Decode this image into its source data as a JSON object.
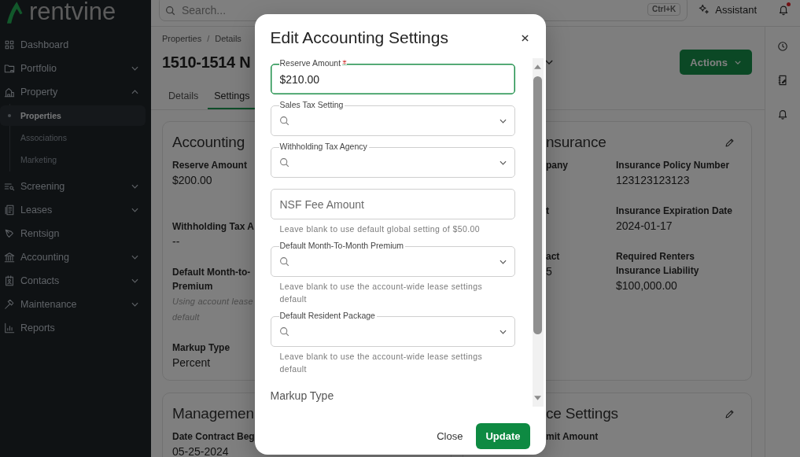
{
  "sidebar": {
    "logo": "rentvine",
    "items": [
      {
        "label": "Dashboard",
        "kind": "link",
        "selected": false
      },
      {
        "label": "Portfolio",
        "kind": "group",
        "selected": false,
        "expanded": false
      },
      {
        "label": "Property",
        "kind": "group",
        "selected": false,
        "expanded": true,
        "children": [
          {
            "label": "Properties",
            "selected": true
          },
          {
            "label": "Associations",
            "selected": false
          },
          {
            "label": "Marketing",
            "selected": false
          }
        ]
      },
      {
        "label": "Screening",
        "kind": "group",
        "selected": false,
        "expanded": false
      },
      {
        "label": "Leases",
        "kind": "group",
        "selected": false,
        "expanded": false
      },
      {
        "label": "Rentsign",
        "kind": "link",
        "selected": false
      },
      {
        "label": "Accounting",
        "kind": "group",
        "selected": false,
        "expanded": false
      },
      {
        "label": "Contacts",
        "kind": "group",
        "selected": false,
        "expanded": false
      },
      {
        "label": "Maintenance",
        "kind": "group",
        "selected": false,
        "expanded": false
      },
      {
        "label": "Reports",
        "kind": "link",
        "selected": false
      }
    ]
  },
  "topbar": {
    "search": {
      "placeholder": "Search...",
      "shortcut": "Ctrl+K"
    },
    "assistant": "Assistant",
    "notifications": {
      "unread": true
    }
  },
  "page": {
    "breadcrumb": {
      "items": [
        "Properties",
        "Details"
      ],
      "separator": "/"
    },
    "title": "1510-1514 N",
    "actions": "Actions",
    "tabs": [
      {
        "label": "Details",
        "selected": false
      },
      {
        "label": "Settings",
        "selected": true
      }
    ]
  },
  "cards": [
    {
      "kind": "left",
      "title": "Accounting",
      "fields": [
        {
          "label": [
            "Reserve Amount"
          ],
          "value": "$200.00"
        },
        {
          "label": [
            "Withholding Tax A"
          ],
          "value": "--"
        },
        {
          "label": [
            "Default Month-to-",
            "Premium"
          ],
          "note": [
            "Using account lease",
            "default"
          ]
        },
        {
          "label": [
            "Markup Type"
          ],
          "value": "Percent"
        }
      ]
    },
    {
      "kind": "right",
      "title": "nsurance",
      "fields": [
        {
          "label": [
            "pany"
          ]
        },
        {
          "label": [
            "Insurance Policy Number"
          ],
          "value": "123123123123"
        },
        {
          "label": [
            "t"
          ]
        },
        {
          "label": [
            "Insurance Expiration Date"
          ],
          "value": "2024-01-17"
        },
        {
          "label": [
            "act"
          ],
          "value": "5"
        },
        {
          "label": [
            "Required Renters Insurance Liability"
          ],
          "value": "$100,000.00"
        }
      ]
    },
    {
      "kind": "left",
      "title": "Managemen",
      "fields": [
        {
          "label": [
            "Date Contract Beg"
          ],
          "value": "05-25-2024"
        }
      ]
    },
    {
      "kind": "right",
      "title": "ce Settings",
      "fields": [
        {
          "label": [
            "mit Amount"
          ]
        }
      ]
    }
  ],
  "modal": {
    "title": "Edit Accounting Settings",
    "fields": [
      {
        "kind": "text",
        "label": "Reserve Amount",
        "required": true,
        "focused": true,
        "value": "$210.00"
      },
      {
        "kind": "select",
        "label": "Sales Tax Setting",
        "required": false,
        "focused": false
      },
      {
        "kind": "select",
        "label": "Withholding Tax Agency",
        "required": false,
        "focused": false
      },
      {
        "kind": "text",
        "placeholder": "NSF Fee Amount",
        "required": false,
        "focused": false,
        "helper": "Leave blank to use default global setting of $50.00"
      },
      {
        "kind": "select",
        "label": "Default Month-To-Month Premium",
        "required": false,
        "focused": false,
        "helper": "Leave blank to use the account-wide lease settings default"
      },
      {
        "kind": "select",
        "label": "Default Resident Package",
        "required": false,
        "focused": false,
        "helper": "Leave blank to use the account-wide lease settings default"
      },
      {
        "kind": "section",
        "label": "Markup Type"
      }
    ],
    "buttons": [
      {
        "label": "Close",
        "kind": "secondary"
      },
      {
        "label": "Update",
        "kind": "primary"
      }
    ]
  }
}
